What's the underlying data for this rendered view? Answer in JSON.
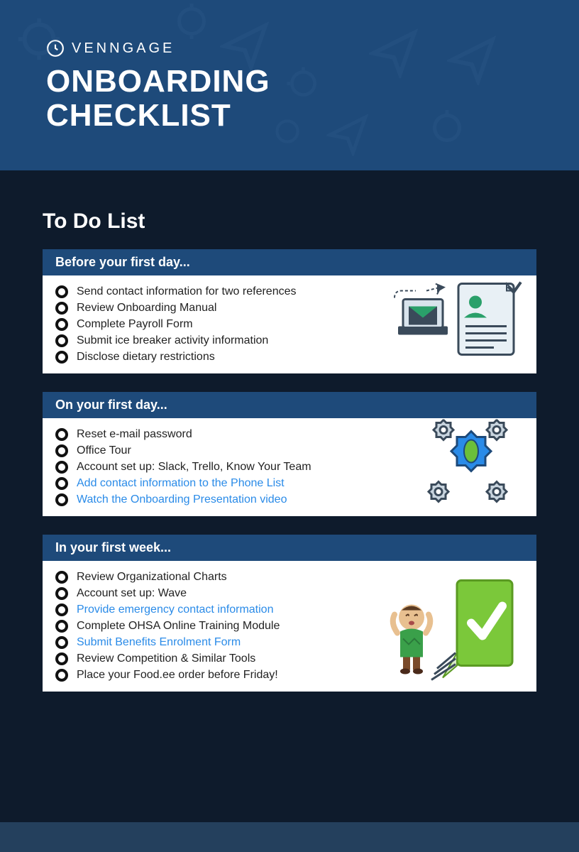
{
  "brand": {
    "name": "VENNGAGE"
  },
  "title_line1": "ONBOARDING",
  "title_line2": "CHECKLIST",
  "section_title": "To Do List",
  "panels": [
    {
      "header": "Before your first day...",
      "items": [
        {
          "label": "Send contact information for two references",
          "link": false
        },
        {
          "label": "Review Onboarding Manual",
          "link": false
        },
        {
          "label": "Complete Payroll Form",
          "link": false
        },
        {
          "label": "Submit ice breaker activity information",
          "link": false
        },
        {
          "label": "Disclose dietary restrictions",
          "link": false
        }
      ]
    },
    {
      "header": "On your first day...",
      "items": [
        {
          "label": "Reset e-mail password",
          "link": false
        },
        {
          "label": "Office Tour",
          "link": false
        },
        {
          "label": "Account set up: Slack, Trello, Know Your Team",
          "link": false
        },
        {
          "label": "Add contact information to the Phone List",
          "link": true
        },
        {
          "label": "Watch the Onboarding Presentation video",
          "link": true
        }
      ]
    },
    {
      "header": "In your first week...",
      "items": [
        {
          "label": "Review Organizational Charts",
          "link": false
        },
        {
          "label": "Account set up: Wave",
          "link": false
        },
        {
          "label": "Provide emergency contact information",
          "link": true
        },
        {
          "label": "Complete OHSA Online Training Module",
          "link": false
        },
        {
          "label": "Submit Benefits Enrolment Form",
          "link": true
        },
        {
          "label": "Review Competition & Similar Tools",
          "link": false
        },
        {
          "label": "Place your Food.ee order before Friday!",
          "link": false
        }
      ]
    }
  ]
}
